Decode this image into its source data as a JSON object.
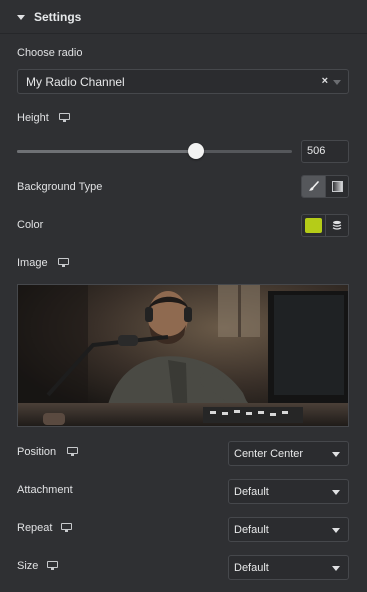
{
  "section": {
    "title": "Settings"
  },
  "choose_radio": {
    "label": "Choose radio",
    "value": "My Radio Channel",
    "clear_glyph": "×"
  },
  "height": {
    "label": "Height",
    "value": "506",
    "slider_fraction": 0.65
  },
  "background_type": {
    "label": "Background Type",
    "options": [
      "classic",
      "gradient"
    ],
    "selected": "classic"
  },
  "color": {
    "label": "Color",
    "swatch": "#b5cc18"
  },
  "image": {
    "label": "Image"
  },
  "position": {
    "label": "Position",
    "value": "Center Center"
  },
  "attachment": {
    "label": "Attachment",
    "value": "Default"
  },
  "repeat": {
    "label": "Repeat",
    "value": "Default"
  },
  "size": {
    "label": "Size",
    "value": "Default"
  },
  "colors": {
    "panel_bg": "#2f3033",
    "field_bg": "#2b2c2f",
    "border": "#46484c",
    "text": "#e0e1e3"
  },
  "icons": {
    "section_toggle": "caret-down-icon",
    "responsive": "desktop-monitor-icon",
    "classic": "paint-brush-icon",
    "gradient": "gradient-icon",
    "global_colors": "stacked-layers-icon"
  }
}
